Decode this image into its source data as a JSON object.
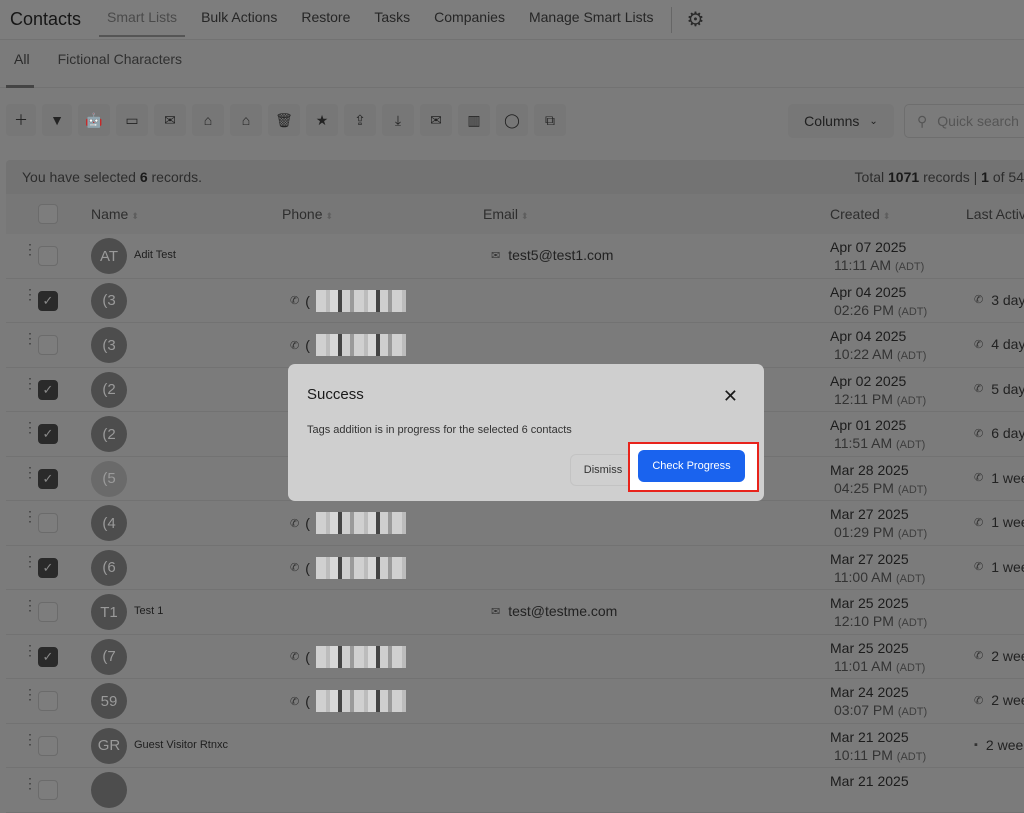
{
  "header": {
    "title": "Contacts",
    "nav": [
      "Smart Lists",
      "Bulk Actions",
      "Restore",
      "Tasks",
      "Companies",
      "Manage Smart Lists"
    ],
    "active": "Smart Lists"
  },
  "subtabs": [
    "All",
    "Fictional Characters"
  ],
  "toolbar": {
    "icons": [
      "plus",
      "filter",
      "robot",
      "message",
      "email",
      "tag-add",
      "tag-remove",
      "trash",
      "star",
      "upload",
      "download",
      "mail-review",
      "building",
      "whatsapp",
      "merge"
    ],
    "columns_label": "Columns",
    "search_placeholder": "Quick search"
  },
  "selection": {
    "prefix": "You have selected",
    "count": "6",
    "suffix": "records.",
    "total_prefix": "Total",
    "total": "1071",
    "total_suffix": "records |",
    "page": "1",
    "page_suffix": "of 54"
  },
  "columns": [
    "Name",
    "Phone",
    "Email",
    "Created",
    "Last Activ"
  ],
  "rows": [
    {
      "initials": "AT",
      "name": "Adit Test",
      "phone": "",
      "email": "test5@test1.com",
      "date": "Apr 07 2025",
      "time": "11:11 AM",
      "tz": "(ADT)",
      "activity": "",
      "act_icon": "",
      "checked": false
    },
    {
      "initials": "(3",
      "name": "",
      "phone": "(",
      "email": "",
      "date": "Apr 04 2025",
      "time": "02:26 PM",
      "tz": "(ADT)",
      "activity": "3 day",
      "act_icon": "phone",
      "checked": true
    },
    {
      "initials": "(3",
      "name": "",
      "phone": "(",
      "email": "",
      "date": "Apr 04 2025",
      "time": "10:22 AM",
      "tz": "(ADT)",
      "activity": "4 day",
      "act_icon": "phone",
      "checked": false
    },
    {
      "initials": "(2",
      "name": "",
      "phone": "(",
      "email": "",
      "date": "Apr 02 2025",
      "time": "12:11 PM",
      "tz": "(ADT)",
      "activity": "5 day",
      "act_icon": "phone",
      "checked": true
    },
    {
      "initials": "(2",
      "name": "",
      "phone": "(",
      "email": "",
      "date": "Apr 01 2025",
      "time": "11:51 AM",
      "tz": "(ADT)",
      "activity": "6 day",
      "act_icon": "phone",
      "checked": true
    },
    {
      "initials": "(5",
      "name": "",
      "phone": "(",
      "email": "",
      "date": "Mar 28 2025",
      "time": "04:25 PM",
      "tz": "(ADT)",
      "activity": "1 wee",
      "act_icon": "phone",
      "checked": true
    },
    {
      "initials": "(4",
      "name": "",
      "phone": "(",
      "email": "",
      "date": "Mar 27 2025",
      "time": "01:29 PM",
      "tz": "(ADT)",
      "activity": "1 wee",
      "act_icon": "phone",
      "checked": false
    },
    {
      "initials": "(6",
      "name": "",
      "phone": "(",
      "email": "",
      "date": "Mar 27 2025",
      "time": "11:00 AM",
      "tz": "(ADT)",
      "activity": "1 wee",
      "act_icon": "phone",
      "checked": true
    },
    {
      "initials": "T1",
      "name": "Test 1",
      "phone": "",
      "email": "test@testme.com",
      "date": "Mar 25 2025",
      "time": "12:10 PM",
      "tz": "(ADT)",
      "activity": "",
      "act_icon": "",
      "checked": false
    },
    {
      "initials": "(7",
      "name": "",
      "phone": "(",
      "email": "",
      "date": "Mar 25 2025",
      "time": "11:01 AM",
      "tz": "(ADT)",
      "activity": "2 wee",
      "act_icon": "phone",
      "checked": true
    },
    {
      "initials": "59",
      "name": "",
      "phone": "(",
      "email": "",
      "date": "Mar 24 2025",
      "time": "03:07 PM",
      "tz": "(ADT)",
      "activity": "2 wee",
      "act_icon": "phone",
      "checked": false
    },
    {
      "initials": "GR",
      "name": "Guest Visitor Rtnxc",
      "phone": "",
      "email": "",
      "date": "Mar 21 2025",
      "time": "10:11 PM",
      "tz": "(ADT)",
      "activity": "2 wee",
      "act_icon": "message",
      "checked": false
    },
    {
      "initials": "",
      "name": "",
      "phone": "",
      "email": "",
      "date": "Mar 21 2025",
      "time": "",
      "tz": "",
      "activity": "",
      "act_icon": "",
      "checked": false
    }
  ],
  "modal": {
    "title": "Success",
    "body": "Tags addition is in progress for the selected 6 contacts",
    "dismiss": "Dismiss",
    "primary": "Check Progress"
  },
  "colors": {
    "primary": "#1a63ee",
    "highlight": "#e8231b"
  }
}
